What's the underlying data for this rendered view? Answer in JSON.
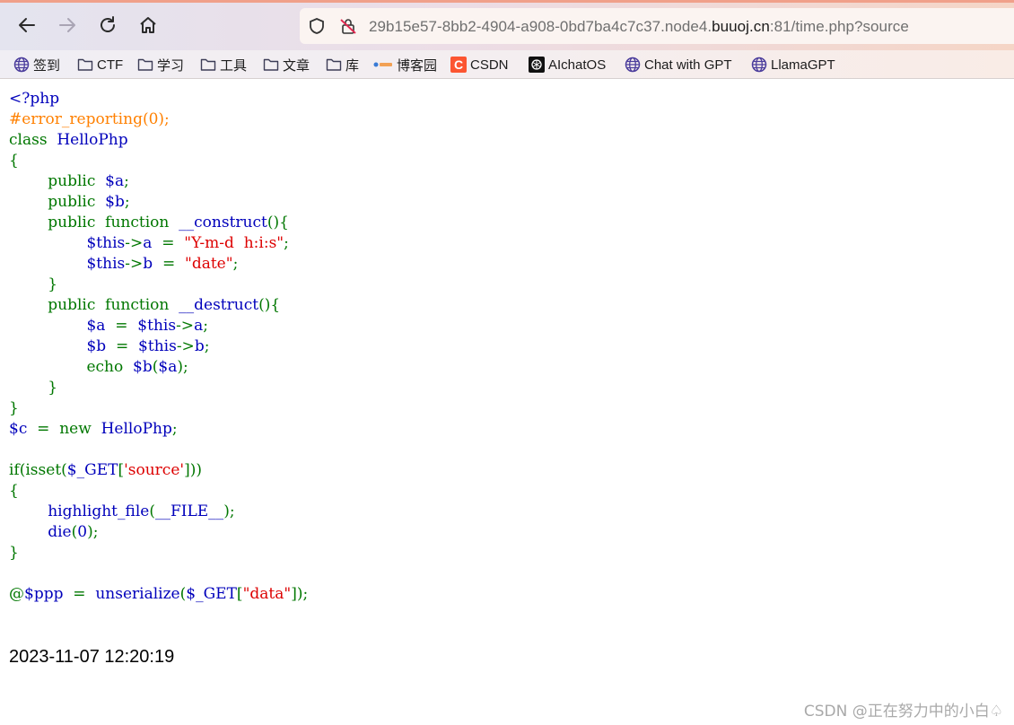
{
  "browser": {
    "url": {
      "prefix": "29b15e57-8bb2-4904-a908-0bd7ba4c7c37.node4.",
      "domain": "buuoj.cn",
      "suffix": ":81/time.php?source"
    },
    "bookmarks": [
      {
        "label": "签到",
        "icon": "globe-icon"
      },
      {
        "label": "CTF",
        "icon": "folder-icon"
      },
      {
        "label": "学习",
        "icon": "folder-icon"
      },
      {
        "label": "工具",
        "icon": "folder-icon"
      },
      {
        "label": "文章",
        "icon": "folder-icon"
      },
      {
        "label": "库",
        "icon": "folder-icon"
      },
      {
        "label": "博客园",
        "icon": "cnblogs-icon"
      },
      {
        "label": "CSDN",
        "icon": "csdn-icon"
      },
      {
        "label": "AIchatOS",
        "icon": "openai-icon"
      },
      {
        "label": "Chat with GPT",
        "icon": "globe-icon"
      },
      {
        "label": "LlamaGPT",
        "icon": "globe-icon"
      }
    ]
  },
  "code": {
    "l1": "<?php",
    "l2": "#error_reporting(0);",
    "l3_kw": "class",
    "l3_name": "HelloPhp",
    "l4": "{",
    "l5_kw": "public",
    "l5_var": "$a",
    "l6_kw": "public",
    "l6_var": "$b",
    "l7_kw": "public",
    "l7_fn": "function",
    "l7_name": "__construct",
    "l8_var": "$this",
    "l8_op": "->",
    "l8_prop": "a",
    "l8_str": "\"Y-m-d  h:i:s\"",
    "l9_var": "$this",
    "l9_op": "->",
    "l9_prop": "b",
    "l9_str": "\"date\"",
    "l10": "}",
    "l11_kw": "public",
    "l11_fn": "function",
    "l11_name": "__destruct",
    "l12_var": "$a",
    "l12_this": "$this",
    "l12_op": "->",
    "l12_prop": "a",
    "l13_var": "$b",
    "l13_this": "$this",
    "l13_op": "->",
    "l13_prop": "b",
    "l14_kw": "echo",
    "l14_expr": "$b",
    "l14_arg": "$a",
    "l15": "}",
    "l16": "}",
    "l17_var": "$c",
    "l17_kw": "new",
    "l17_name": "HelloPhp",
    "l19_kw": "if",
    "l19_fn": "isset",
    "l19_var": "$_GET",
    "l19_str": "'source'",
    "l20": "{",
    "l21_fn": "highlight_file",
    "l21_arg": "__FILE__",
    "l22_fn": "die",
    "l22_arg": "0",
    "l23": "}",
    "l25_at": "@",
    "l25_var": "$ppp",
    "l25_fn": "unserialize",
    "l25_get": "$_GET",
    "l25_str": "\"data\""
  },
  "output_text": "2023-11-07 12:20:19",
  "watermark": "CSDN @正在努力中的小白♤",
  "colors": {
    "keyword": "#007700",
    "default": "#0000bb",
    "string": "#dd0000",
    "comment": "#ff8000"
  }
}
